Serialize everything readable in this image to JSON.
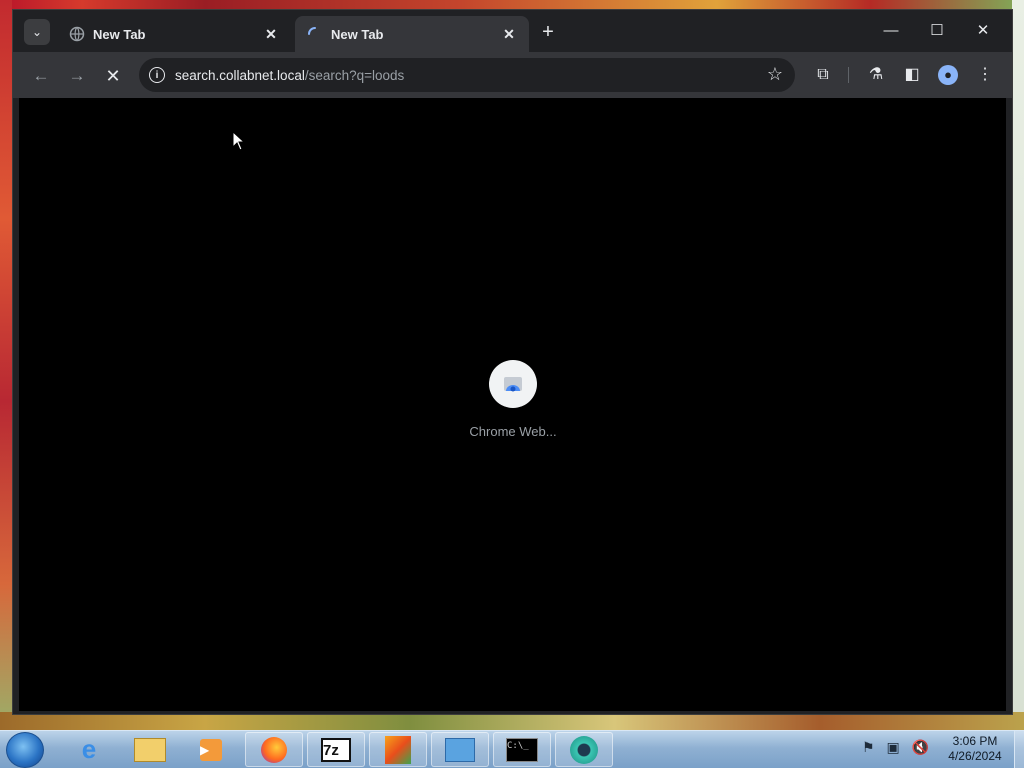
{
  "tabs": [
    {
      "label": "New Tab",
      "favicon": "globe-icon",
      "loading": false
    },
    {
      "label": "New Tab",
      "favicon": "spinner-icon",
      "loading": true
    }
  ],
  "window_controls": {
    "minimize": "—",
    "maximize": "☐",
    "close": "✕"
  },
  "toolbar": {
    "url_host": "search.collabnet.local",
    "url_path": "/search?q=loods"
  },
  "content": {
    "loading_label": "Chrome Web...",
    "background": "#000000"
  },
  "taskbar": {
    "apps": [
      "Internet Explorer",
      "Windows Explorer",
      "Media Player",
      "Firefox",
      "7-Zip",
      "Paint",
      "Control Panel",
      "Command Prompt",
      "Chrome Web App"
    ],
    "clock_time": "3:06 PM",
    "clock_date": "4/26/2024"
  },
  "colors": {
    "chrome_dark": "#202124",
    "toolbar": "#35363a",
    "accent": "#8ab4f8"
  }
}
